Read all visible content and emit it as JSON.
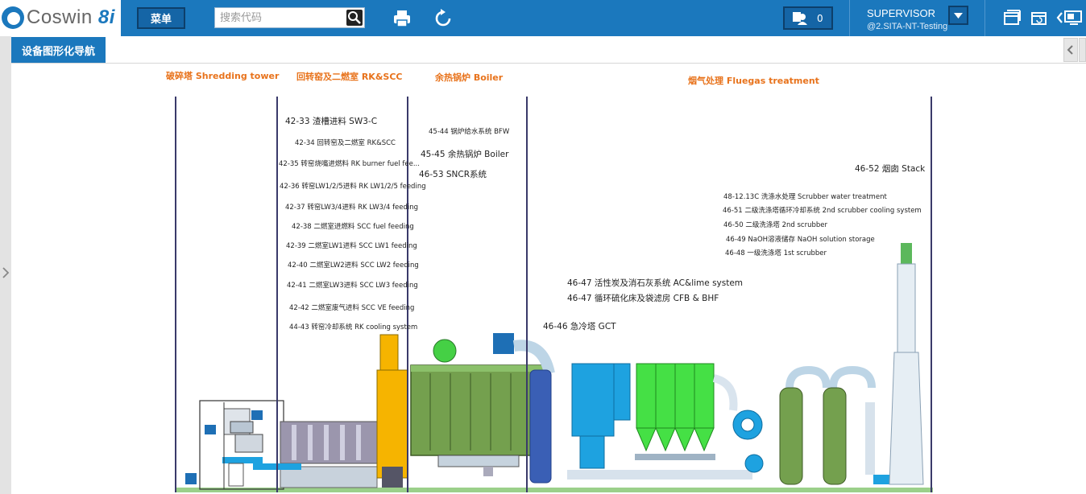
{
  "app": {
    "logo_text": "Coswin ",
    "logo_version": "8i"
  },
  "toolbar": {
    "menu_label": "菜单",
    "search_placeholder": "搜索代码",
    "notification_count": "0"
  },
  "user": {
    "name": "SUPERVISOR",
    "site": "@2.SITA-NT-Testing"
  },
  "tab": {
    "active_label": "设备图形化导航"
  },
  "sections": {
    "shredding": "破碎塔 Shredding tower",
    "rk_scc": "回转窑及二燃室 RK&SCC",
    "boiler": "余热锅炉 Boiler",
    "fluegas": "烟气处理 Fluegas treatment"
  },
  "labels": {
    "l_42_33": "42-33 渣槽进料 SW3-C",
    "l_42_34": "42-34 回转窑及二燃室 RK&SCC",
    "l_42_35": "42-35 转窑烧嘴进燃料 RK burner fuel fee...",
    "l_42_36": "42-36 转窑LW1/2/5进料 RK LW1/2/5 feeding",
    "l_42_37": "42-37 转窑LW3/4进料 RK LW3/4 feeding",
    "l_42_38": "42-38 二燃室进燃料 SCC fuel feeding",
    "l_42_39": "42-39 二燃室LW1进料 SCC LW1 feeding",
    "l_42_40": "42-40 二燃室LW2进料 SCC LW2 feeding",
    "l_42_41": "42-41 二燃室LW3进料 SCC LW3 feeding",
    "l_42_42": "42-42 二燃室废气进料 SCC VE feeding",
    "l_44_43": "44-43 转窑冷却系统 RK cooling system",
    "l_45_44": "45-44 锅炉给水系统 BFW",
    "l_45_45": "45-45 余热锅炉 Boiler",
    "l_46_53": "46-53 SNCR系统",
    "l_46_52": "46-52 烟囱 Stack",
    "l_48_12": "48-12.13C 洗涤水处理 Scrubber water treatment",
    "l_46_51": "46-51 二级洗涤塔循环冷却系统 2nd scrubber cooling system",
    "l_46_50": "46-50 二级洗涤塔 2nd scrubber",
    "l_46_49": "46-49 NaOH溶液储存 NaOH solution storage",
    "l_46_48": "46-48 一级洗涤塔 1st scrubber",
    "l_46_47a": "46-47 活性炭及消石灰系统 AC&lime system",
    "l_46_47b": "46-47 循环硫化床及袋滤房 CFB & BHF",
    "l_46_46": "46-46 急冷塔 GCT"
  },
  "colors": {
    "topbar": "#1b78bd",
    "section_title": "#e8731c",
    "divider": "#3a3a6a",
    "boiler_green": "#74a04e",
    "chimney_yellow": "#f6b400",
    "fluegas_blue": "#1ea2e0",
    "filter_green": "#45e045"
  }
}
